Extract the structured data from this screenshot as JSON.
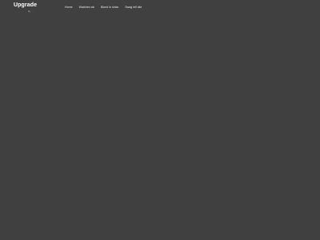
{
  "header": {
    "logo": {
      "text": "Upgrade",
      "subtitle": "by ·  ·  ·"
    },
    "nav": {
      "items": [
        {
          "label": "Home"
        },
        {
          "label": "Watches wb"
        },
        {
          "label": "Blond in sinks"
        },
        {
          "label": "Swag tell site"
        }
      ]
    }
  },
  "colors": {
    "background": "#404040",
    "text": "#ffffff",
    "nav_text": "#e6e6e6"
  }
}
